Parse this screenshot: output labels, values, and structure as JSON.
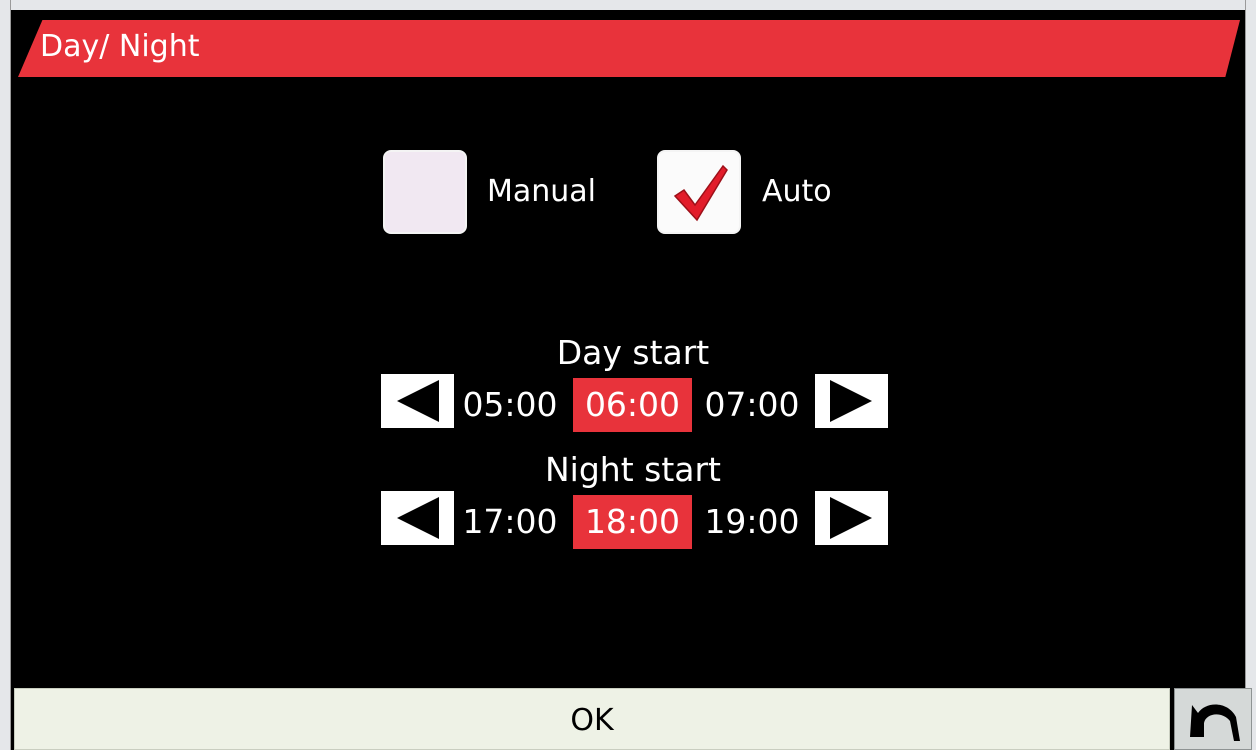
{
  "window": {
    "title": "Day/ Night"
  },
  "mode": {
    "manual": {
      "label": "Manual",
      "checked": false
    },
    "auto": {
      "label": "Auto",
      "checked": true
    }
  },
  "day_start": {
    "title": "Day start",
    "prev": "05:00",
    "selected": "06:00",
    "next": "07:00"
  },
  "night_start": {
    "title": "Night start",
    "prev": "17:00",
    "selected": "18:00",
    "next": "19:00"
  },
  "footer": {
    "ok_label": "OK"
  },
  "icons": {
    "check": "checkmark-icon",
    "left_arrow": "triangle-left-icon",
    "right_arrow": "triangle-right-icon",
    "back": "undo-arrow-icon"
  },
  "colors": {
    "accent": "#e8333b",
    "background": "#000000",
    "text": "#ffffff",
    "ok_button": "#eef2e6"
  }
}
